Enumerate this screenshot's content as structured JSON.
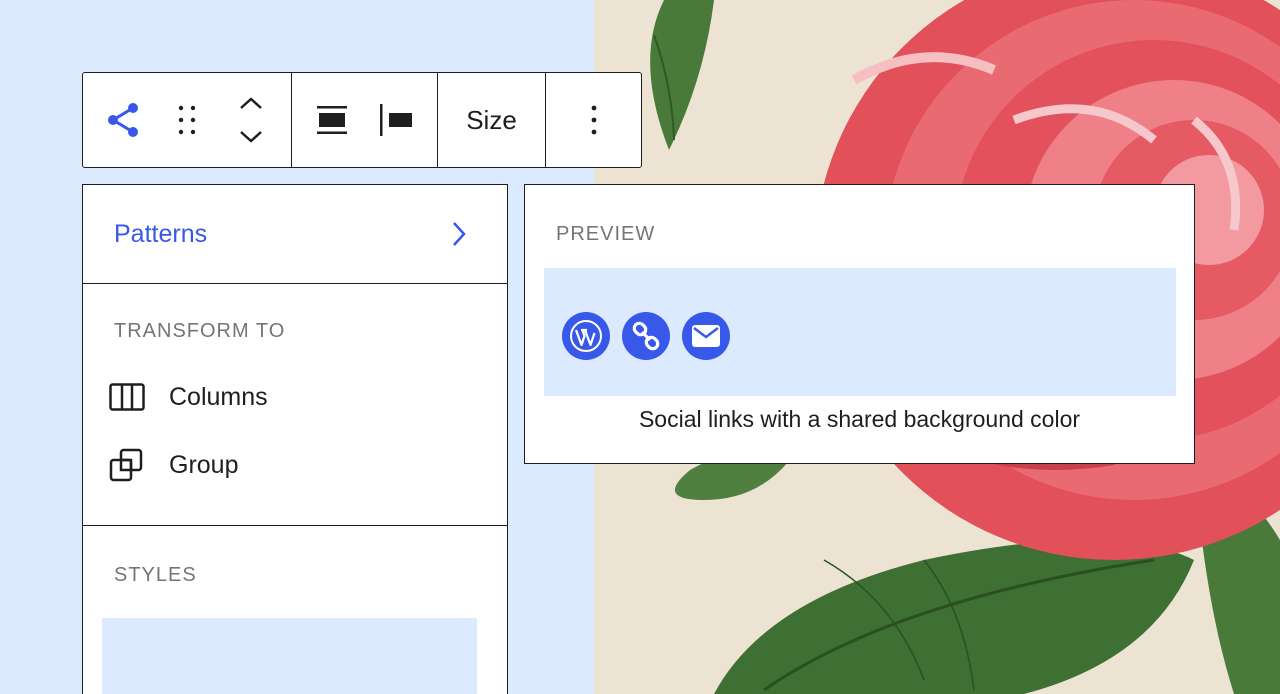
{
  "toolbar": {
    "share_icon": "share-icon",
    "drag_icon": "drag-handle-icon",
    "move_icon": "move-up-down-icon",
    "align_icon": "justify-center-icon",
    "justify_icon": "justify-left-icon",
    "size_label": "Size",
    "more_icon": "more-vertical-icon"
  },
  "dropdown": {
    "patterns_label": "Patterns",
    "transform_title": "TRANSFORM TO",
    "transform_items": [
      {
        "label": "Columns",
        "icon": "columns-icon"
      },
      {
        "label": "Group",
        "icon": "group-icon"
      }
    ],
    "styles_title": "STYLES"
  },
  "preview": {
    "title": "PREVIEW",
    "caption": "Social links with a shared background color",
    "icons": [
      "wordpress-icon",
      "link-icon",
      "mail-icon"
    ]
  },
  "colors": {
    "accent": "#3858e9",
    "canvas": "#dbeafe",
    "border": "#1e1e1e",
    "muted": "#757575"
  }
}
